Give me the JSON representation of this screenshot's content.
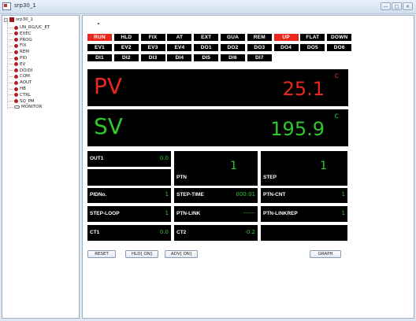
{
  "window": {
    "title": "srp30_1",
    "min_glyph": "—",
    "max_glyph": "□",
    "close_glyph": "✕"
  },
  "tree": {
    "root": "srp30_1",
    "expander": "−",
    "items": [
      "UN_RG/UC_ET",
      "EXEC",
      "PROG",
      "FIX",
      "REM",
      "PID",
      "EV",
      "DO/DI",
      "COM",
      "AOUT",
      "HB",
      "CTRL",
      "SQ_PM",
      "MONITOR"
    ]
  },
  "lamps": {
    "row1": [
      {
        "label": "RUN",
        "on": true
      },
      {
        "label": "HLD",
        "on": false
      },
      {
        "label": "FIX",
        "on": false
      },
      {
        "label": "AT",
        "on": false
      },
      {
        "label": "EXT",
        "on": false
      },
      {
        "label": "GUA",
        "on": false
      },
      {
        "label": "REM",
        "on": false
      },
      {
        "label": "UP",
        "on": true
      },
      {
        "label": "FLAT",
        "on": false
      },
      {
        "label": "DOWN",
        "on": false
      }
    ],
    "row2": [
      "EV1",
      "EV2",
      "EV3",
      "EV4",
      "DO1",
      "DO2",
      "DO3",
      "DO4",
      "DO5",
      "DO6"
    ],
    "row3": [
      "DI1",
      "DI2",
      "DI3",
      "DI4",
      "DI5",
      "DI6",
      "DI7"
    ]
  },
  "pv": {
    "label": "PV",
    "value": "25.1",
    "unit": "c"
  },
  "sv": {
    "label": "SV",
    "value": "195.9",
    "unit": "c"
  },
  "panels": {
    "out1": {
      "label": "OUT1",
      "value": "0.0"
    },
    "ptn": {
      "label": "PTN",
      "value": "1"
    },
    "step": {
      "label": "STEP",
      "value": "1"
    },
    "pidno": {
      "label": "PIDNo.",
      "value": "1"
    },
    "step_time": {
      "label": "STEP-TIME",
      "value": "000:01"
    },
    "ptn_cnt": {
      "label": "PTN-CNT",
      "value": "1"
    },
    "step_loop": {
      "label": "STEP-LOOP",
      "value": "1"
    },
    "ptn_link": {
      "label": "PTN-LINK",
      "value": "------"
    },
    "ptn_linkrep": {
      "label": "PTN-LINKREP",
      "value": "1"
    },
    "ct1": {
      "label": "CT1",
      "value": "0.0"
    },
    "ct2": {
      "label": "CT2",
      "value": "-0.2"
    }
  },
  "buttons": {
    "reset": "RESET",
    "hld": "HLD[ ON]",
    "adv": "ADV[ ON]",
    "graph": "GRAPH"
  },
  "colors": {
    "lamp_on": "#e8281c",
    "lamp_off": "#000000",
    "pv": "#e8281c",
    "sv": "#2fc82f"
  }
}
